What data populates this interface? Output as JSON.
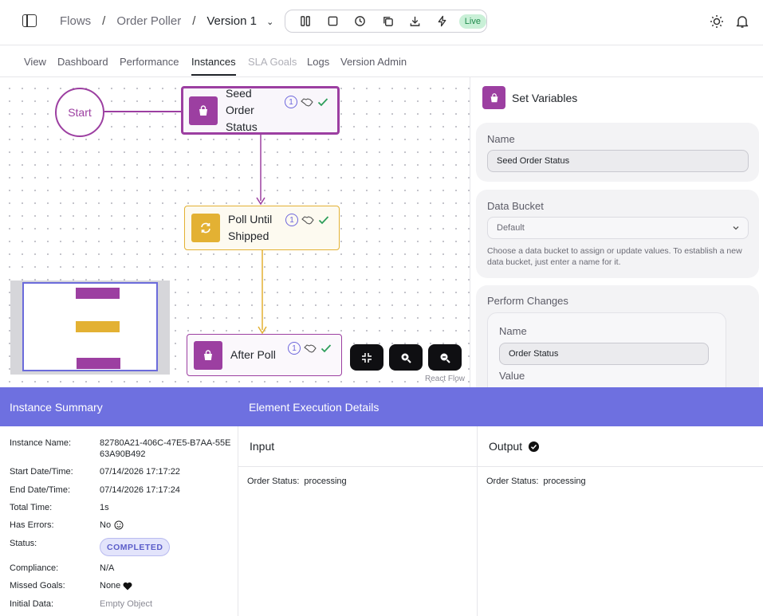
{
  "header": {
    "breadcrumbs": [
      "Flows",
      "Order Poller"
    ],
    "version": "Version 1",
    "live_label": "Live",
    "toolbar_icons": [
      "columns-icon",
      "stop-icon",
      "history-icon",
      "copy-icon",
      "download-icon",
      "bolt-icon"
    ]
  },
  "tabs": [
    {
      "label": "View"
    },
    {
      "label": "Dashboard"
    },
    {
      "label": "Performance"
    },
    {
      "label": "Instances",
      "active": true
    },
    {
      "label": "SLA Goals",
      "disabled": true
    },
    {
      "label": "Logs"
    },
    {
      "label": "Version Admin"
    }
  ],
  "canvas": {
    "start_label": "Start",
    "nodes": [
      {
        "label": "Seed Order Status",
        "count": "1",
        "type": "set-variables",
        "color": "#9c3fa1"
      },
      {
        "label": "Poll Until Shipped",
        "count": "1",
        "type": "loop",
        "color": "#e3b133"
      },
      {
        "label": "After Poll",
        "count": "1",
        "type": "set-variables",
        "color": "#9c3fa1"
      }
    ],
    "attribution": "React Flow"
  },
  "panel": {
    "title": "Set Variables",
    "name_label": "Name",
    "name_value": "Seed Order Status",
    "bucket_label": "Data Bucket",
    "bucket_value": "Default",
    "bucket_help": "Choose a data bucket to assign or update values. To establish a new data bucket, just enter a name for it.",
    "changes_label": "Perform Changes",
    "change_name_label": "Name",
    "change_name_value": "Order Status",
    "change_value_label": "Value"
  },
  "bottom": {
    "summary_title": "Instance Summary",
    "details_title": "Element Execution Details",
    "summary": {
      "instance_name_label": "Instance Name:",
      "instance_name_value": "82780A21-406C-47E5-B7AA-55E63A90B492",
      "start_label": "Start Date/Time:",
      "start_value": "07/14/2026 17:17:22",
      "end_label": "End Date/Time:",
      "end_value": "07/14/2026 17:17:24",
      "total_label": "Total Time:",
      "total_value": "1s",
      "errors_label": "Has Errors:",
      "errors_value": "No",
      "status_label": "Status:",
      "status_value": "COMPLETED",
      "compliance_label": "Compliance:",
      "compliance_value": "N/A",
      "missed_label": "Missed Goals:",
      "missed_value": "None",
      "initial_label": "Initial Data:",
      "initial_value": "Empty Object"
    },
    "input": {
      "title": "Input",
      "key": "Order Status:",
      "value": "processing"
    },
    "output": {
      "title": "Output",
      "key": "Order Status:",
      "value": "processing"
    }
  },
  "colors": {
    "purple": "#9c3fa1",
    "yellow": "#e3b133",
    "accent": "#6e70e0",
    "live_green": "#1f8a4c"
  }
}
